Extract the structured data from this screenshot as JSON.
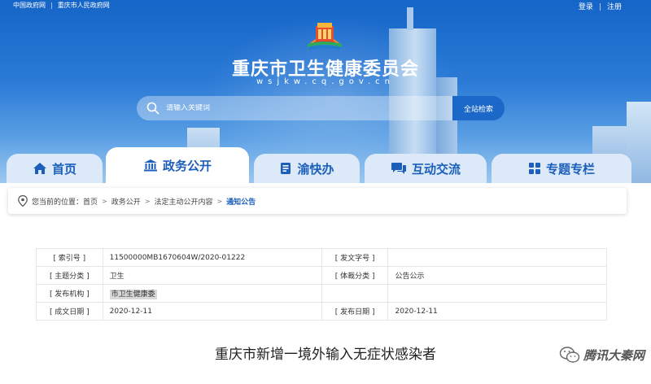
{
  "header": {
    "top_links": [
      "中国政府网",
      "重庆市人民政府网"
    ],
    "login": "登录",
    "register": "注册",
    "site_title": "重庆市卫生健康委员会",
    "site_domain": "wsjkw.cq.gov.cn"
  },
  "search": {
    "placeholder": "请输入关键词",
    "button_label": "全站检索"
  },
  "nav": {
    "tabs": [
      {
        "label": "首页",
        "icon": "home-icon",
        "active": false
      },
      {
        "label": "政务公开",
        "icon": "government-building-icon",
        "active": true
      },
      {
        "label": "渝快办",
        "icon": "document-icon",
        "active": false
      },
      {
        "label": "互动交流",
        "icon": "chat-icon",
        "active": false
      },
      {
        "label": "专题专栏",
        "icon": "grid-icon",
        "active": false
      }
    ]
  },
  "breadcrumb": {
    "prefix": "您当前的位置：",
    "items": [
      "首页",
      "政务公开",
      "法定主动公开内容"
    ],
    "current": "通知公告"
  },
  "meta": {
    "rows": [
      {
        "label1": "[ 索引号 ]",
        "value1": "11500000MB1670604W/2020-01222",
        "label2": "[ 发文字号 ]",
        "value2": ""
      },
      {
        "label1": "[ 主题分类 ]",
        "value1": "卫生",
        "label2": "[ 体裁分类 ]",
        "value2": "公告公示"
      },
      {
        "label1": "[ 发布机构 ]",
        "value1": "市卫生健康委",
        "label2": "",
        "value2": ""
      },
      {
        "label1": "[ 成文日期 ]",
        "value1": "2020-12-11",
        "label2": "[ 发布日期 ]",
        "value2": "2020-12-11"
      }
    ]
  },
  "article": {
    "title": "重庆市新增一境外输入无症状感染者"
  },
  "watermark": {
    "text": "腾讯大秦网"
  },
  "colors": {
    "primary": "#1c5fba",
    "search_button": "#1c68c9",
    "banner_top": "#1565c8"
  }
}
